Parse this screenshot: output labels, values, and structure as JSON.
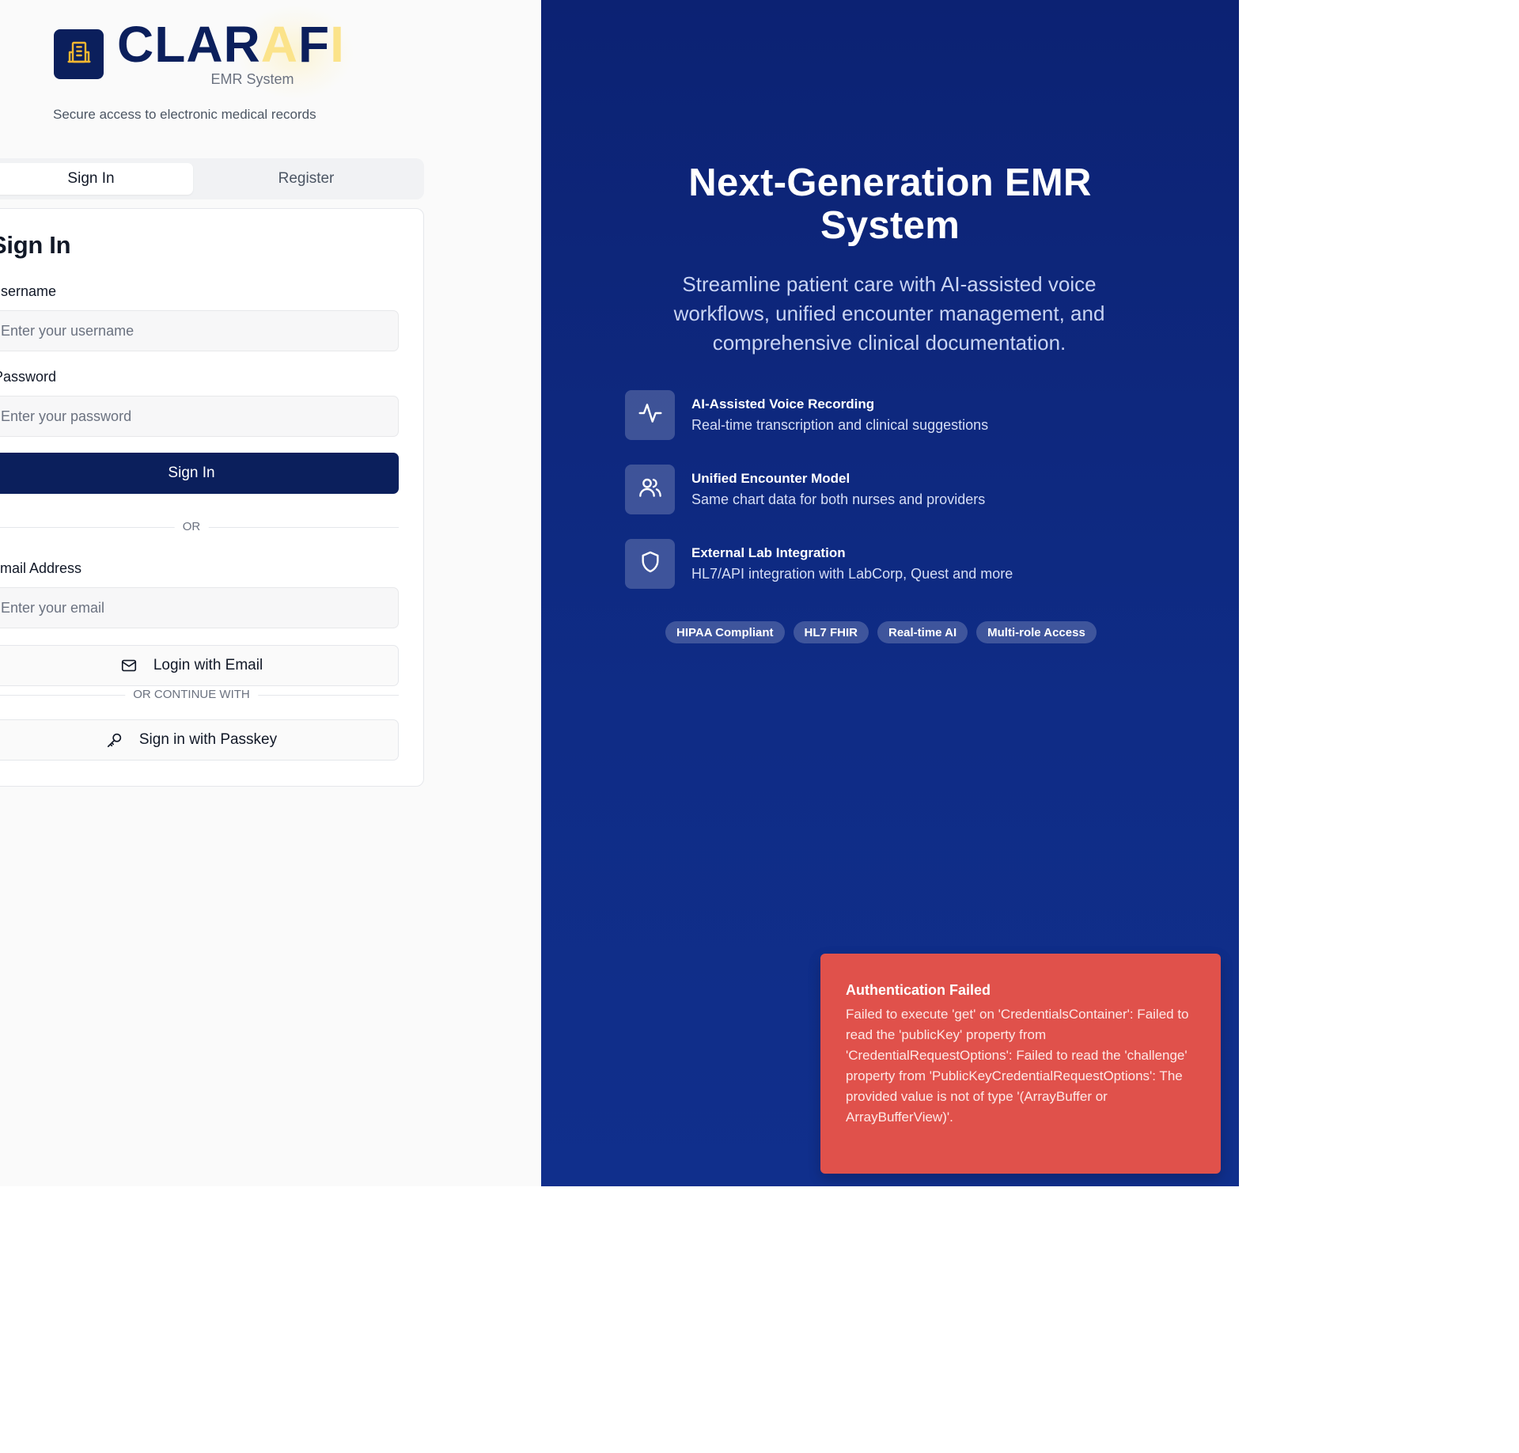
{
  "brand": {
    "name_part1": "CLAR",
    "name_part2": "A",
    "name_part3": "F",
    "name_part4": "I",
    "subtitle": "EMR System",
    "tagline": "Secure access to electronic medical records"
  },
  "tabs": [
    {
      "label": "Sign In",
      "active": true
    },
    {
      "label": "Register",
      "active": false
    }
  ],
  "signin": {
    "title": "Sign In",
    "username_label": "Username",
    "username_placeholder": "Enter your username",
    "password_label": "Password",
    "password_placeholder": "Enter your password",
    "submit_label": "Sign In",
    "or_text": "OR",
    "email_label": "Email Address",
    "email_placeholder": "Enter your email",
    "email_button_label": "Login with Email",
    "continue_text": "OR CONTINUE WITH",
    "passkey_button_label": "Sign in with Passkey"
  },
  "hero": {
    "title_line1": "Next-Generation EMR",
    "title_line2": "System",
    "subtitle": "Streamline patient care with AI-assisted voice workflows, unified encounter management, and comprehensive clinical documentation."
  },
  "features": [
    {
      "icon": "activity-icon",
      "title": "AI-Assisted Voice Recording",
      "desc": "Real-time transcription and clinical suggestions"
    },
    {
      "icon": "users-icon",
      "title": "Unified Encounter Model",
      "desc": "Same chart data for both nurses and providers"
    },
    {
      "icon": "shield-icon",
      "title": "External Lab Integration",
      "desc": "HL7/API integration with LabCorp, Quest and more"
    }
  ],
  "badges": [
    "HIPAA Compliant",
    "HL7 FHIR",
    "Real-time AI",
    "Multi-role Access"
  ],
  "toast": {
    "title": "Authentication Failed",
    "message": "Failed to execute 'get' on 'CredentialsContainer': Failed to read the 'publicKey' property from 'CredentialRequestOptions': Failed to read the 'challenge' property from 'PublicKeyCredentialRequestOptions': The provided value is not of type '(ArrayBuffer or ArrayBufferView)'."
  },
  "colors": {
    "brand_navy": "#0b1f5c",
    "accent_gold": "#fbe38a",
    "hero_bg": "#0f2c86",
    "toast_red": "#e0514b"
  }
}
